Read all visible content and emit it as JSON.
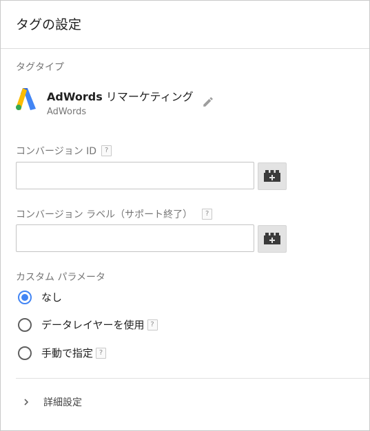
{
  "header": {
    "title": "タグの設定"
  },
  "tag_type": {
    "label": "タグタイプ",
    "name_bold": "AdWords",
    "name_rest": " リマーケティング",
    "vendor": "AdWords",
    "logo": "adwords-logo",
    "edit_icon": "pencil-icon"
  },
  "conversion_id": {
    "label": "コンバージョン ID",
    "help": "?",
    "value": "",
    "variable_icon": "lego-brick-plus-icon"
  },
  "conversion_label": {
    "label": "コンバージョン ラベル（サポート終了）",
    "help": "?",
    "value": "",
    "variable_icon": "lego-brick-plus-icon"
  },
  "custom_params": {
    "label": "カスタム パラメータ",
    "options": [
      {
        "label": "なし",
        "selected": true,
        "help": ""
      },
      {
        "label": "データレイヤーを使用",
        "selected": false,
        "help": "?"
      },
      {
        "label": "手動で指定",
        "selected": false,
        "help": "?"
      }
    ]
  },
  "advanced": {
    "label": "詳細設定",
    "icon": "chevron-right-icon"
  },
  "colors": {
    "accent": "#4285f4",
    "adwords_blue": "#4285f4",
    "adwords_yellow": "#fbbc04",
    "adwords_green": "#34a853"
  }
}
